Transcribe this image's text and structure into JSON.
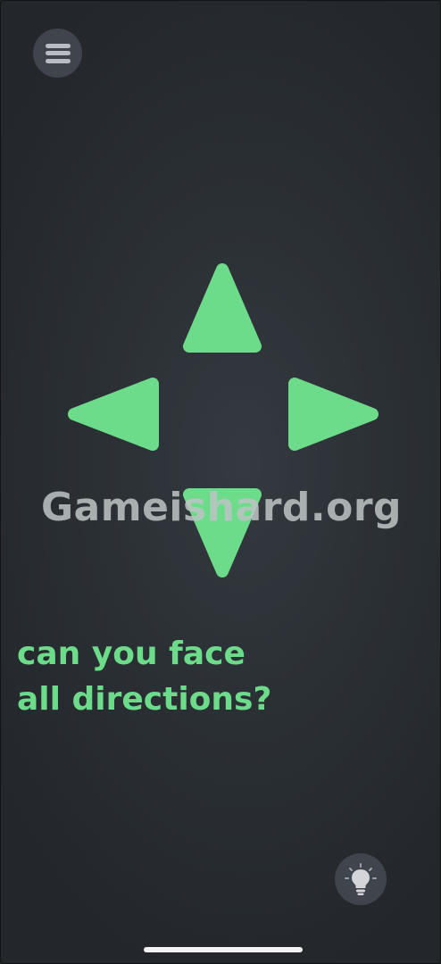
{
  "game": {
    "prompt_line1": "can you face",
    "prompt_line2": "all directions?",
    "watermark": "Gameishard.org",
    "accent_color": "#6ddc8a",
    "arrows": [
      "up",
      "left",
      "right",
      "down"
    ]
  },
  "icons": {
    "menu": "menu-icon",
    "hint": "lightbulb-icon"
  }
}
